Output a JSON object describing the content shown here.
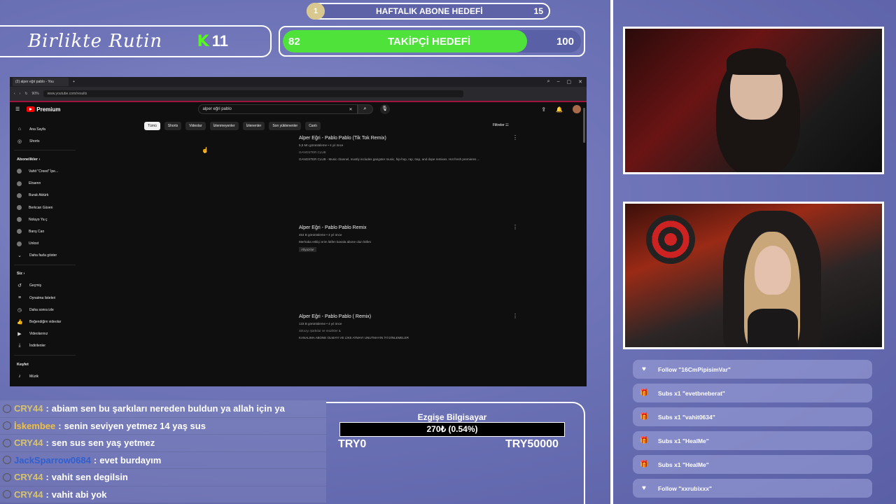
{
  "overlay": {
    "brand": "Birlikte Rutin",
    "kick_count": "11",
    "weekly_goal": {
      "start": "1",
      "label": "HAFTALIK ABONE HEDEFİ",
      "target": "15"
    },
    "follow_goal": {
      "current": "82",
      "label": "TAKİPÇİ HEDEFİ",
      "target": "100",
      "progress": 0.82,
      "fill_color": "#4ee23a"
    }
  },
  "browser": {
    "tab_title": "(2) alper eğri pablo - You",
    "url": "www.youtube.com/results",
    "zoom": "90%",
    "youtube": {
      "logo_text": "Premium",
      "search_query": "alper eğri pablo",
      "sidebar": {
        "top": [
          {
            "label": "Ana Sayfa",
            "icon": "home-icon"
          },
          {
            "label": "Shorts",
            "icon": "shorts-icon"
          }
        ],
        "subscriptions_header": "Abonelikler",
        "subscriptions": [
          "Vahit \"Creed\" İpe...",
          "Elraenn",
          "Burak Aktürk",
          "Berkcan Güven",
          "Noluyo Ya ç",
          "Barış Can",
          "Unlost",
          "Daha fazla göster"
        ],
        "you_header": "Siz",
        "you": [
          {
            "label": "Geçmiş",
            "icon": "history-icon"
          },
          {
            "label": "Oynatma listeleri",
            "icon": "playlist-icon"
          },
          {
            "label": "Daha sonra izle",
            "icon": "clock-icon"
          },
          {
            "label": "Beğendiğim videolar",
            "icon": "like-icon"
          },
          {
            "label": "Videolarınız",
            "icon": "video-icon"
          },
          {
            "label": "İndirilenler",
            "icon": "download-icon"
          }
        ],
        "explore_header": "Keşfet",
        "explore": [
          {
            "label": "Müzik",
            "icon": "music-icon"
          }
        ]
      },
      "chips": [
        "Tümü",
        "Shorts",
        "Videolar",
        "İzlenmeyenler",
        "İzlenenler",
        "Son yüklenenler",
        "Canlı"
      ],
      "filters_label": "Filtreler",
      "results": [
        {
          "title": "Alper Eğri - Pablo Pablo (Tik Tok Remix)",
          "meta": "5,5 Mn görüntüleme • 4 yıl önce",
          "channel": "GANGSTER CLUB",
          "desc": "GANGSTER CLUB - Music channel, mostly includes gangster music, hip-hop, rap, trap, and dope remixes. Hot fresh premieres ..."
        },
        {
          "title": "Alper Eğri - Pablo Pablo Remix",
          "meta": "464 B görüntüleme • 4 yıl önce",
          "channel": "",
          "desc": "Merhaba rekliçi erim lütfen kanala abone olun lütfen",
          "tag": "Altyazılar"
        },
        {
          "title": "Alper Eğri - Pablo Pablo ( Remix)",
          "meta": "133 B görüntüleme • 4 yıl önce",
          "channel": "Sıkıcıyı Şarkılar ve müzikler &",
          "desc": "KANALIMA ABONE OLMAYI VE LİKE ATMAYI UNUTMAYIN İYİ DİNLEMELER"
        }
      ]
    }
  },
  "chat": [
    {
      "user": "CRY44",
      "color": "#d7c46a",
      "message": "abiam sen bu şarkıları nereden buldun ya allah için ya"
    },
    {
      "user": "İskembee",
      "color": "#f0c040",
      "message": "senin seviyen yetmez 14 yaş sus"
    },
    {
      "user": "CRY44",
      "color": "#d7c46a",
      "message": "sen sus sen yaş yetmez"
    },
    {
      "user": "JackSparrow0684",
      "color": "#2f5fd0",
      "message": "evet burdayım"
    },
    {
      "user": "CRY44",
      "color": "#d7c46a",
      "message": "vahit sen degilsin"
    },
    {
      "user": "CRY44",
      "color": "#d7c46a",
      "message": "vahit abi yok"
    }
  ],
  "donation": {
    "title": "Ezgişe Bilgisayar",
    "amount": "270₺ (0.54%)",
    "min": "TRY0",
    "max": "TRY50000",
    "progress": 0.0054
  },
  "alerts": [
    {
      "icon": "heart-icon",
      "glyph": "♥",
      "text": "Follow \"16CmPipisimVar\""
    },
    {
      "icon": "gift-icon",
      "glyph": "🎁",
      "text": "Subs x1 \"evetbneberat\""
    },
    {
      "icon": "gift-icon",
      "glyph": "🎁",
      "text": "Subs x1 \"vahit0634\""
    },
    {
      "icon": "gift-icon",
      "glyph": "🎁",
      "text": "Subs x1 \"HealMe\""
    },
    {
      "icon": "gift-icon",
      "glyph": "🎁",
      "text": "Subs x1 \"HealMe\""
    },
    {
      "icon": "heart-icon",
      "glyph": "♥",
      "text": "Follow \"xxrubixxx\""
    }
  ]
}
